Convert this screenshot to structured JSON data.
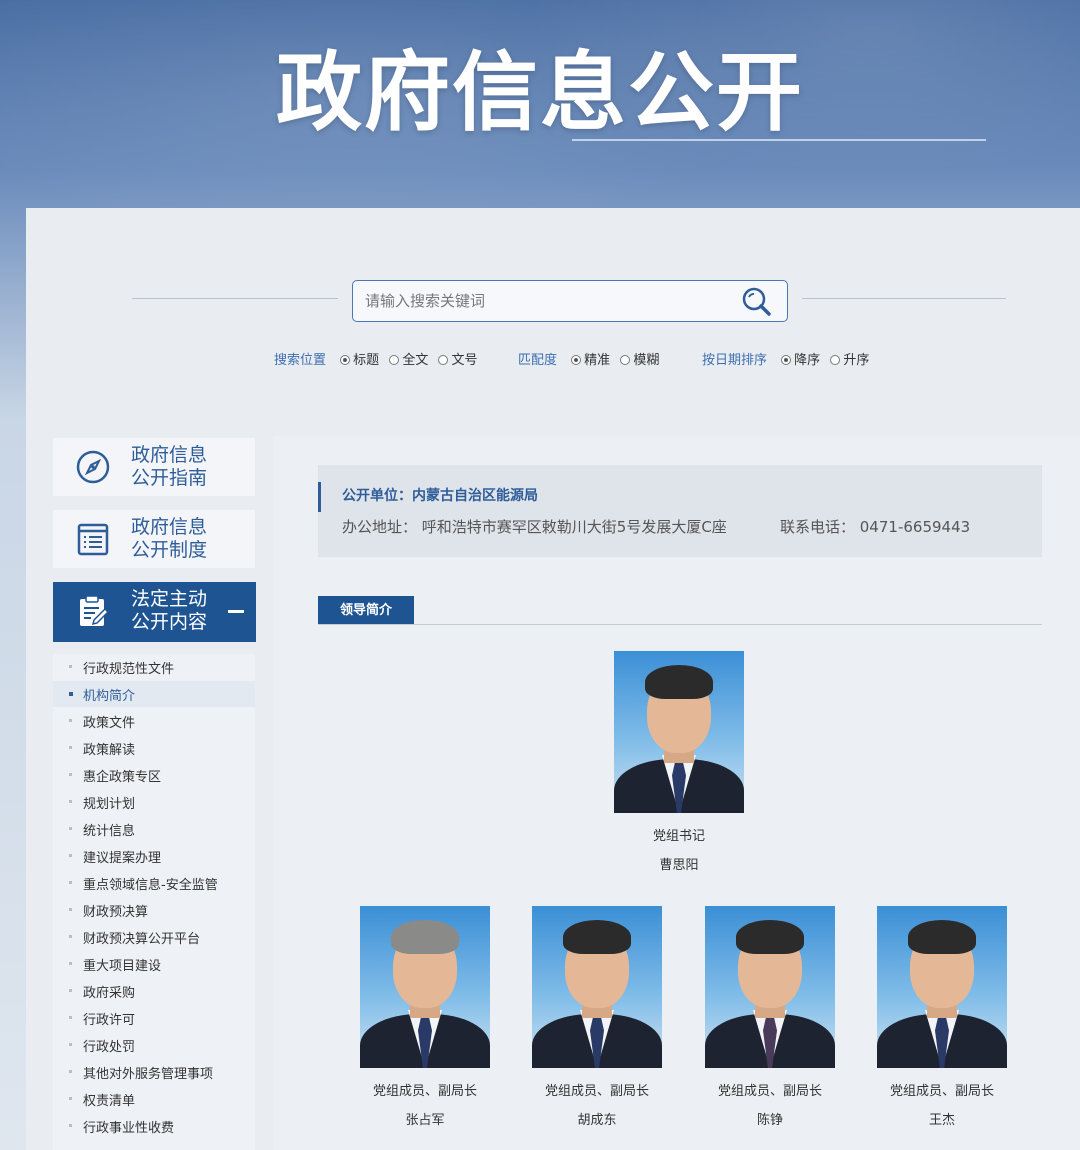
{
  "banner": {
    "title": "政府信息公开"
  },
  "search": {
    "placeholder": "请输入搜索关键词",
    "position": {
      "label": "搜索位置",
      "options": [
        "标题",
        "全文",
        "文号"
      ],
      "selected": "标题"
    },
    "match": {
      "label": "匹配度",
      "options": [
        "精准",
        "模糊"
      ],
      "selected": "精准"
    },
    "sort": {
      "label": "按日期排序",
      "options": [
        "降序",
        "升序"
      ],
      "selected": "降序"
    }
  },
  "sidebar": {
    "cards": [
      {
        "line1": "政府信息",
        "line2": "公开指南",
        "icon": "compass-icon"
      },
      {
        "line1": "政府信息",
        "line2": "公开制度",
        "icon": "document-list-icon"
      },
      {
        "line1": "法定主动",
        "line2": "公开内容",
        "icon": "edit-document-icon"
      }
    ],
    "items": [
      "行政规范性文件",
      "机构简介",
      "政策文件",
      "政策解读",
      "惠企政策专区",
      "规划计划",
      "统计信息",
      "建议提案办理",
      "重点领域信息-安全监管",
      "财政预决算",
      "财政预决算公开平台",
      "重大项目建设",
      "政府采购",
      "行政许可",
      "行政处罚",
      "其他对外服务管理事项",
      "权责清单",
      "行政事业性收费"
    ],
    "active_item": "机构简介"
  },
  "info": {
    "unit": "公开单位：内蒙古自治区能源局",
    "address": "办公地址：  呼和浩特市赛罕区敕勒川大街5号发展大厦C座",
    "phone": "联系电话：  0471-6659443"
  },
  "section": {
    "title": "领导简介"
  },
  "leaders": [
    {
      "title": "党组书记",
      "name": "曹思阳"
    },
    {
      "title": "党组成员、副局长",
      "name": "张占军"
    },
    {
      "title": "党组成员、副局长",
      "name": "胡成东"
    },
    {
      "title": "党组成员、副局长",
      "name": "陈铮"
    },
    {
      "title": "党组成员、副局长",
      "name": "王杰"
    }
  ],
  "colors": {
    "primary": "#1f5493",
    "accent_text": "#2f5d99",
    "panel": "#e9edf2"
  }
}
